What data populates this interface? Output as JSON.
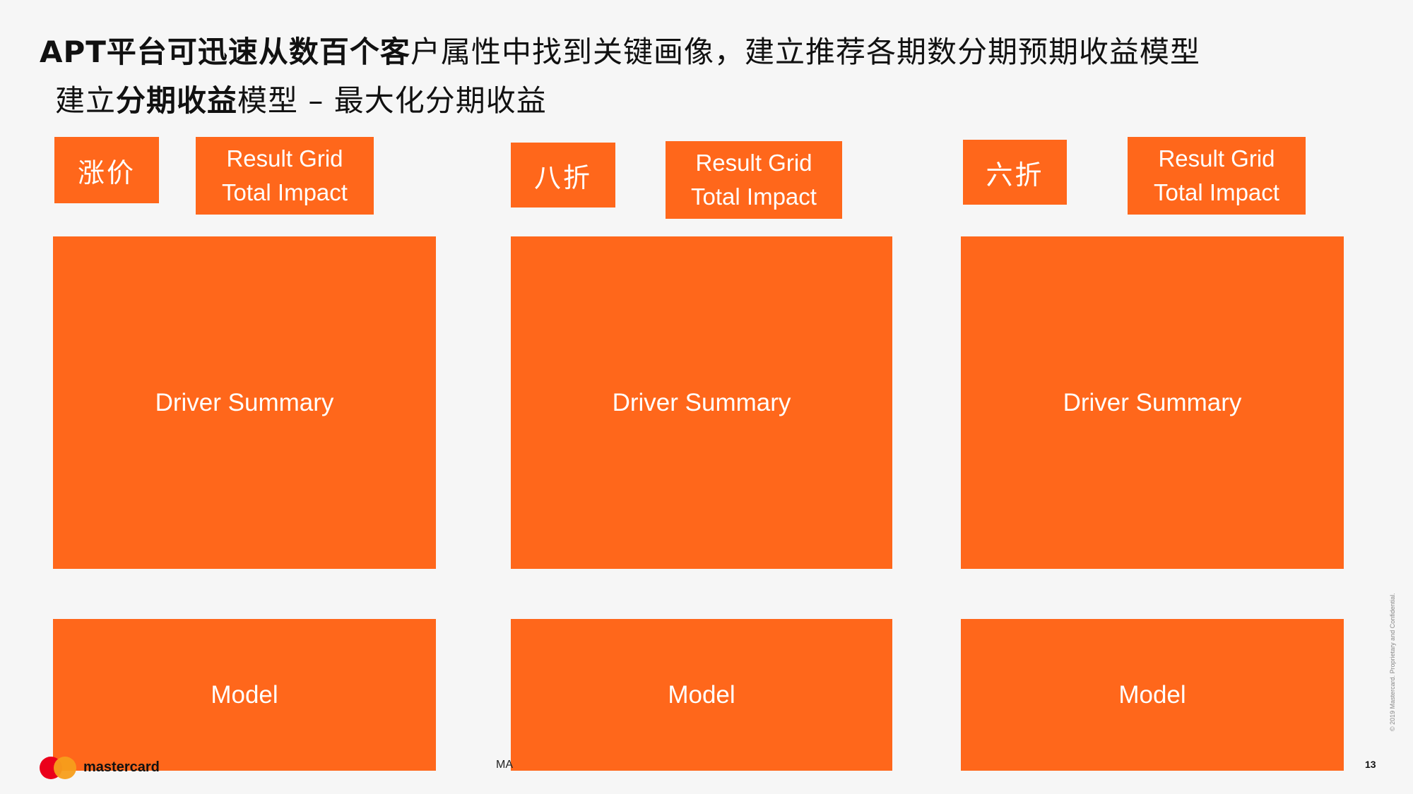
{
  "header": {
    "title_bold": "APT平台可迅速从数百个客",
    "title_rest": "户属性中找到关键画像，建立推荐各期数分期预期收益模型",
    "subtitle_a": "建立",
    "subtitle_b": "分期收益",
    "subtitle_c": "模型 – 最大化分期收益"
  },
  "columns": [
    {
      "tag": "涨价",
      "grid_line1": "Result Grid",
      "grid_line2": "Total Impact",
      "driver": "Driver Summary",
      "model": "Model"
    },
    {
      "tag": "八折",
      "grid_line1": "Result Grid",
      "grid_line2": "Total Impact",
      "driver": "Driver Summary",
      "model": "Model"
    },
    {
      "tag": "六折",
      "grid_line1": "Result Grid",
      "grid_line2": "Total Impact",
      "driver": "Driver Summary",
      "model": "Model"
    }
  ],
  "footer": {
    "brand": "mastercard",
    "mid_text": "MA",
    "page_number": "13",
    "side_note": "© 2019 Mastercard. Proprietary and Confidential."
  },
  "colors": {
    "accent": "#ff671b",
    "background": "#f6f6f6",
    "logo_red": "#eb001b",
    "logo_yellow": "#f79e1b"
  }
}
